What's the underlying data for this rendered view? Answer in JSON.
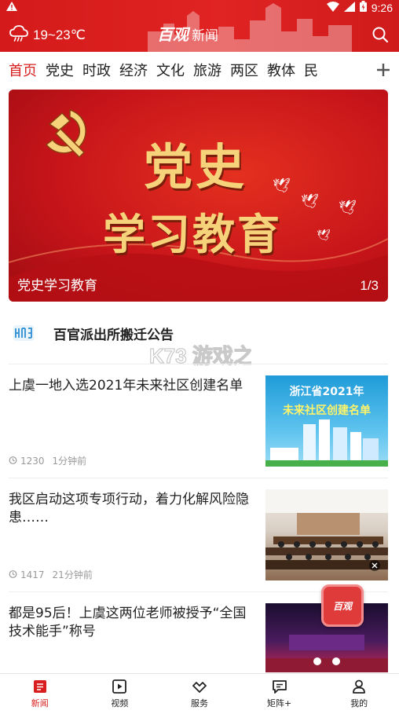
{
  "status_bar": {
    "time": "9:26",
    "icons": [
      "alert-icon",
      "wifi-icon",
      "signal-icon",
      "battery-icon"
    ]
  },
  "header": {
    "weather": "19~23℃",
    "logo_main": "百观",
    "logo_sub": "新闻",
    "search_icon": "search-icon"
  },
  "tabs": [
    "首页",
    "党史",
    "时政",
    "经济",
    "文化",
    "旅游",
    "两区",
    "教体",
    "民"
  ],
  "tabs_more_icon": "plus-icon",
  "banner": {
    "title_line1": "党史",
    "title_line2": "学习教育",
    "caption": "党史学习教育",
    "pager": "1/3"
  },
  "notice": {
    "text": "百官派出所搬迁公告"
  },
  "watermark": {
    "text": "K73 游戏之家"
  },
  "news": [
    {
      "title": "上虞一地入选2021年未来社区创建名单",
      "views": "1230",
      "time": "1分钟前",
      "thumb_line1": "浙江省2021年",
      "thumb_line2": "未来社区创建名单"
    },
    {
      "title": "我区启动这项专项行动，着力化解风险隐患……",
      "views": "1417",
      "time": "21分钟前"
    },
    {
      "title": "都是95后！上虞这两位老师被授予“全国技术能手”称号"
    }
  ],
  "float_logo": "百观",
  "bottom_nav": [
    {
      "label": "新闻",
      "icon": "news-icon",
      "active": true
    },
    {
      "label": "视频",
      "icon": "video-icon",
      "active": false
    },
    {
      "label": "服务",
      "icon": "service-icon",
      "active": false
    },
    {
      "label": "矩阵+",
      "icon": "matrix-icon",
      "active": false
    },
    {
      "label": "我的",
      "icon": "profile-icon",
      "active": false
    }
  ],
  "colors": {
    "brand_red": "#d81e1e",
    "banner_gold": "#f6d27a",
    "meta_grey": "#999999"
  }
}
